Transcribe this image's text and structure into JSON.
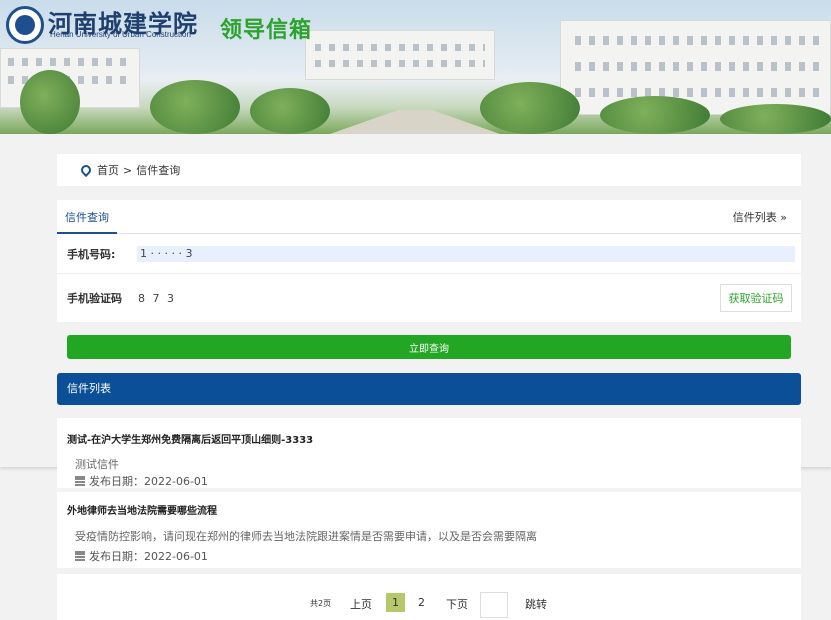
{
  "header": {
    "school_name": "河南城建学院",
    "school_en": "Henan University of Urban Construction",
    "site_title": "领导信箱"
  },
  "breadcrumb": {
    "home": "首页",
    "separator": ">",
    "current": "信件查询"
  },
  "tabs": {
    "active": "信件查询",
    "right_link": "信件列表 »"
  },
  "form": {
    "phone_label": "手机号码:",
    "phone_value": "1 · · ·        · · 3",
    "code_label": "手机验证码",
    "code_value": "8 7   3",
    "get_code_button": "获取验证码"
  },
  "submit_button": "立即查询",
  "list": {
    "title": "信件列表",
    "items": [
      {
        "title": "测试-在沪大学生郑州免费隔离后返回平顶山细则-3333",
        "desc": "测试信件",
        "date": "发布日期：2022-06-01"
      },
      {
        "title": "外地律师去当地法院需要哪些流程",
        "desc": "受疫情防控影响，请问现在郑州的律师去当地法院跟进案情是否需要申请，以及是否会需要隔离",
        "date": "发布日期：2022-06-01"
      }
    ]
  },
  "pagination": {
    "total": "共2页",
    "prev": "上页",
    "current": "1",
    "page2": "2",
    "next": "下页",
    "jump": "跳转"
  },
  "colors": {
    "brand_blue": "#0b4f98",
    "accent_green": "#22a623",
    "page_current": "#b5c96a"
  }
}
